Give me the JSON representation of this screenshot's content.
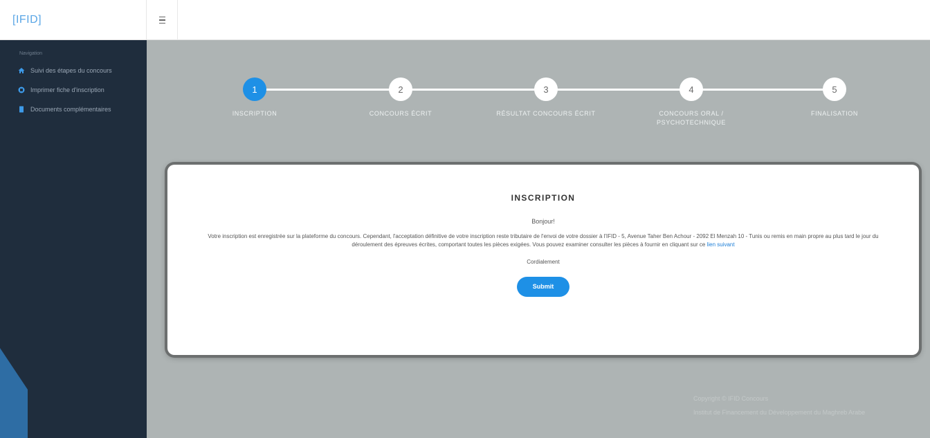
{
  "brand": {
    "logo_text": "[IFID]"
  },
  "sidebar": {
    "section_title": "Navigation",
    "items": [
      {
        "label": "Suivi des étapes du concours",
        "icon": "home-icon"
      },
      {
        "label": "Imprimer fiche d'inscription",
        "icon": "print-icon"
      },
      {
        "label": "Documents complémentaires",
        "icon": "document-icon"
      }
    ]
  },
  "stepper": {
    "steps": [
      {
        "number": "1",
        "label": "Inscription",
        "active": true
      },
      {
        "number": "2",
        "label": "Concours écrit",
        "active": false
      },
      {
        "number": "3",
        "label": "Résultat concours écrit",
        "active": false
      },
      {
        "number": "4",
        "label": "Concours oral / psychotechnique",
        "active": false
      },
      {
        "number": "5",
        "label": "Finalisation",
        "active": false
      }
    ]
  },
  "card": {
    "title": "INSCRIPTION",
    "greeting": "Bonjour!",
    "body_text": "Votre inscription est enregistrée sur la plateforme du concours. Cependant, l'acceptation définitive de votre inscription reste tributaire de l'envoi de votre dossier à l'IFID - 5, Avenue Taher Ben Achour - 2092 El Menzah 10 - Tunis ou remis en main propre au plus tard le jour du déroulement des épreuves écrites, comportant toutes les pièces exigées. Vous pouvez examiner consulter les pièces à fournir en cliquant sur ce",
    "link_text": "lien suivant",
    "signoff": "Cordialement",
    "submit_label": "Submit"
  },
  "footer": {
    "line1": "Copyright © IFID Concours",
    "line2": "Institut de Financement du Développement du Maghreb Arabe"
  },
  "colors": {
    "accent": "#1e90e6",
    "sidebar_bg": "#1f2d3d",
    "main_bg": "#aeb4b4",
    "brand_text": "#5aa6e6"
  }
}
